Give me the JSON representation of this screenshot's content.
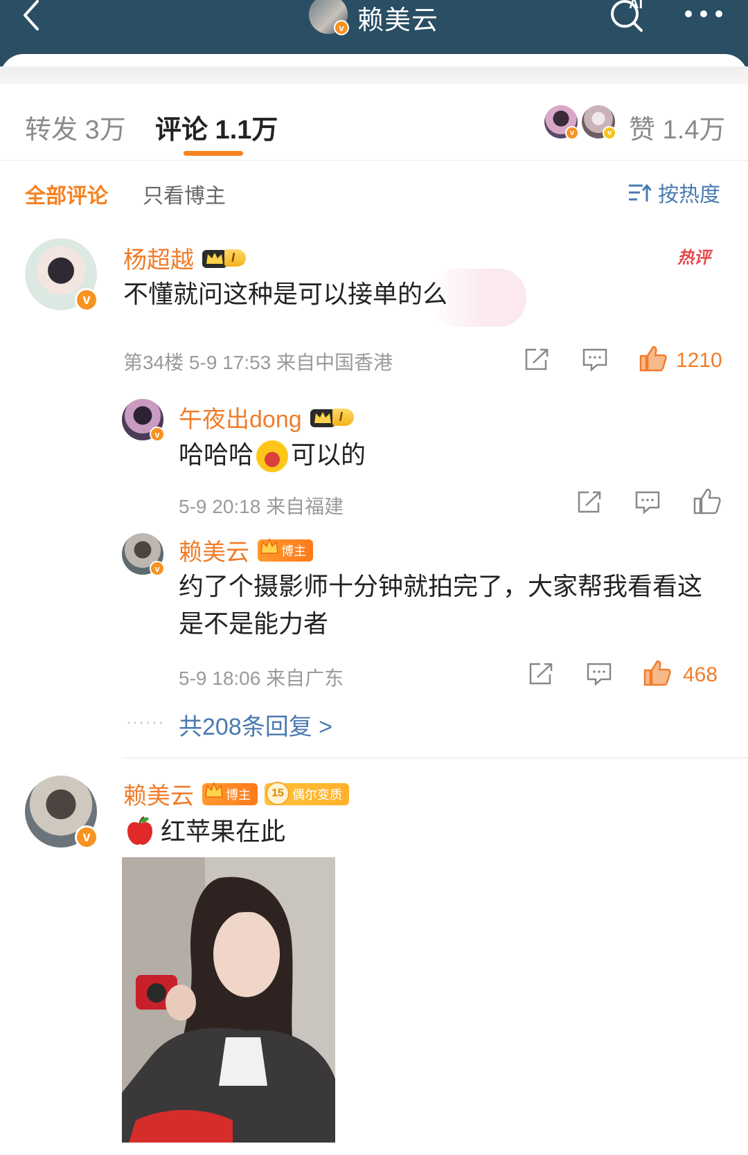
{
  "header": {
    "title": "赖美云",
    "ai_label": "AI",
    "icons": [
      "back-arrow-icon",
      "ai-search-icon",
      "more-icon"
    ]
  },
  "tabs": {
    "repost": "转发 3万",
    "comments": "评论 1.1万",
    "likes": "赞 1.4万"
  },
  "filters": {
    "all": "全部评论",
    "host_only": "只看博主",
    "sort": "按热度"
  },
  "comments": [
    {
      "user": "杨超越",
      "level": "I",
      "text": "不懂就问这种是可以接单的么",
      "hot": "热评",
      "meta": "第34楼 5-9 17:53 来自中国香港",
      "likes": "1210",
      "replies": [
        {
          "user": "午夜出dong",
          "level": "I",
          "text_before": "哈哈哈",
          "text_after": "可以的",
          "meta": "5-9 20:18 来自福建"
        },
        {
          "user": "赖美云",
          "badge": "博主",
          "text": "约了个摄影师十分钟就拍完了，大家帮我看看这是不是能力者",
          "meta": "5-9 18:06 来自广东",
          "likes": "468"
        }
      ],
      "replies_link": "共208条回复 >"
    },
    {
      "user": "赖美云",
      "badge": "博主",
      "fan_level": "15",
      "fan_badge": "偶尔变质",
      "text": "红苹果在此"
    }
  ],
  "colors": {
    "header_bg": "#2a4e63",
    "accent": "#f58220",
    "link": "#4a7ab0"
  }
}
